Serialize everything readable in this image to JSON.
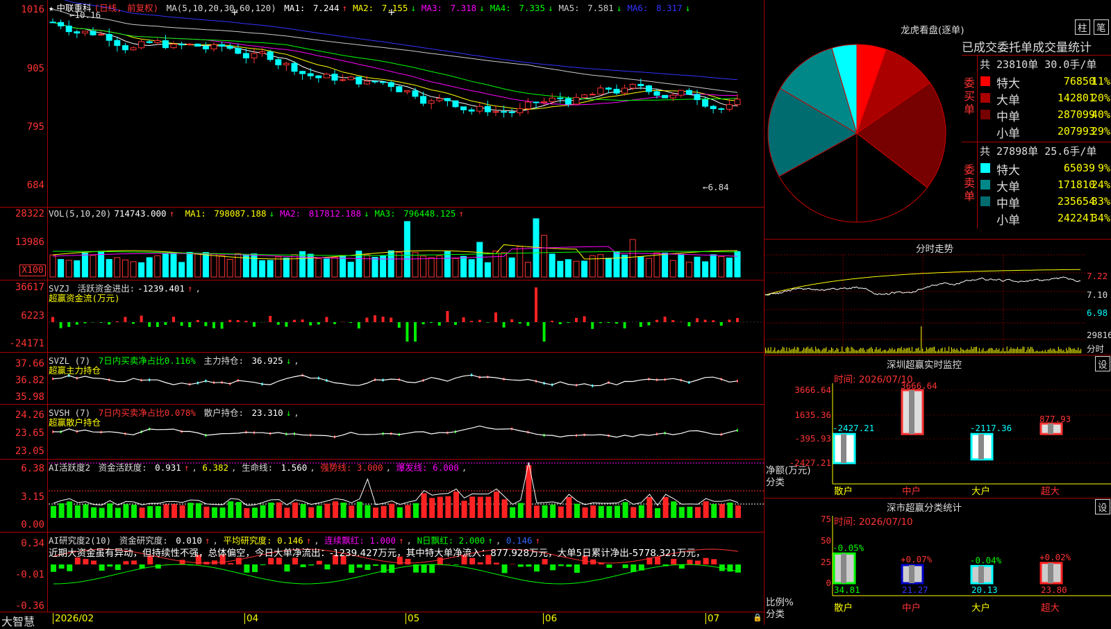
{
  "kline": {
    "title": "中联重科",
    "period": "(日线, 前复权)",
    "ma_def": "MA(5,10,20,30,60,120)",
    "ma": [
      {
        "label": "MA1:",
        "value": "7.244",
        "arrow": "↑",
        "color": "#ffffff"
      },
      {
        "label": "MA2:",
        "value": "7.155",
        "arrow": "↓",
        "color": "#ffff00"
      },
      {
        "label": "MA3:",
        "value": "7.318",
        "arrow": "↓",
        "color": "#ff00ff"
      },
      {
        "label": "MA4:",
        "value": "7.335",
        "arrow": "↓",
        "color": "#00ff00"
      },
      {
        "label": "MA5:",
        "value": "7.581",
        "arrow": "↓",
        "color": "#cccccc"
      },
      {
        "label": "MA6:",
        "value": "8.317",
        "arrow": "↓",
        "color": "#3333ff"
      }
    ],
    "y_ticks": [
      "1016",
      "905",
      "795",
      "684"
    ],
    "high_label": "10.16",
    "low_label": "6.84"
  },
  "vol": {
    "def": "VOL(5,10,20)",
    "value": "714743.000",
    "ma": [
      {
        "label": "MA1:",
        "value": "798087.188",
        "arrow": "↓",
        "color": "#ffff00"
      },
      {
        "label": "MA2:",
        "value": "817812.188",
        "arrow": "↓",
        "color": "#ff00ff"
      },
      {
        "label": "MA3:",
        "value": "796448.125",
        "arrow": "↑",
        "color": "#00ff00"
      }
    ],
    "y_ticks": [
      "28322",
      "13986"
    ],
    "unit": "X100"
  },
  "svzj": {
    "name": "SVZJ",
    "label": "活跃资金进出:",
    "value": "-1239.401",
    "sub": "超赢资金流(万元)",
    "y_ticks": [
      "36617",
      "6223",
      "-24171"
    ]
  },
  "svzl": {
    "name": "SVZL (7)",
    "label7": "7日内买卖净占比0.116%",
    "label2": "主力持仓:",
    "value": "36.925",
    "sub": "超赢主力持仓",
    "y_ticks": [
      "37.66",
      "36.82",
      "35.98"
    ]
  },
  "svsh": {
    "name": "SVSH (7)",
    "label7": "7日内买卖净占比0.078%",
    "label2": "散户持仓:",
    "value": "23.310",
    "sub": "超赢散户持仓",
    "y_ticks": [
      "24.26",
      "23.65",
      "23.05"
    ]
  },
  "ai1": {
    "name": "AI活跃度2",
    "l1": "资金活跃度:",
    "v1": "0.931",
    "v2": "6.382",
    "l3": "生命线:",
    "v3": "1.560",
    "l4": "强势线: 3.000",
    "l5": "爆发线: 6.000",
    "y_ticks": [
      "6.38",
      "3.15",
      "0.00"
    ]
  },
  "ai2": {
    "name": "AI研究度2(10)",
    "l1": "资金研究度:",
    "v1": "0.010",
    "l2": "平均研究度: 0.146",
    "l3": "连续飘红: 1.000",
    "l4": "N日飘红: 2.000",
    "v5": "0.146",
    "comment": "近期大资金虽有异动，但持续性不强，总体偏空，今日大单净流出：-1239.427万元，其中特大单净流入：877.928万元，大单5日累计净出-5778.321万元，",
    "y_ticks": [
      "0.34",
      "-0.01",
      "-0.36"
    ]
  },
  "bottom": {
    "brand": "大智慧",
    "dates": [
      "2026/02",
      "04",
      "05",
      "06",
      "07"
    ]
  },
  "dragon": {
    "title": "龙虎看盘(逐单)",
    "btn1": "柱",
    "btn2": "笔",
    "subtitle": "已成交委托单成交量统计",
    "buy_label": "委买单",
    "sell_label": "委卖单",
    "buy_total": "共 23810单 30.0手/单",
    "sell_total": "共 27898单 25.6手/单",
    "buy_rows": [
      {
        "name": "特大",
        "vol": "76850",
        "pct": "11%",
        "color": "#ff0000"
      },
      {
        "name": "大单",
        "vol": "142801",
        "pct": "20%",
        "color": "#aa0000"
      },
      {
        "name": "中单",
        "vol": "287099",
        "pct": "40%",
        "color": "#770000"
      },
      {
        "name": "小单",
        "vol": "207993",
        "pct": "29%",
        "color": "#000000"
      }
    ],
    "sell_rows": [
      {
        "name": "特大",
        "vol": "65039",
        "pct": "9%",
        "color": "#00ffff"
      },
      {
        "name": "大单",
        "vol": "171810",
        "pct": "24%",
        "color": "#008888"
      },
      {
        "name": "中单",
        "vol": "235654",
        "pct": "33%",
        "color": "#006c70"
      },
      {
        "name": "小单",
        "vol": "242241",
        "pct": "34%",
        "color": "#000000"
      }
    ]
  },
  "intraday": {
    "title": "分时走势",
    "y_ticks": [
      "7.22",
      "7.10",
      "6.98"
    ],
    "vol_label": "29816",
    "vol_label2": "分时"
  },
  "monitor": {
    "title": "深圳超赢实时监控",
    "btn": "设",
    "time": "时间: 2026/07/10",
    "y_ticks": [
      "3666.64",
      "1635.36",
      "-395.93",
      "-2427.21"
    ],
    "y_title": "净额(万元)",
    "x_title": "分类",
    "bars": [
      {
        "name": "散户",
        "value": "-2427.21",
        "label_color": "#00ffff",
        "name_color": "#ffff00"
      },
      {
        "name": "中户",
        "value": "3666.64",
        "label_color": "#ff3333",
        "name_color": "#ff3333"
      },
      {
        "name": "大户",
        "value": "-2117.36",
        "label_color": "#00ffff",
        "name_color": "#ffff00"
      },
      {
        "name": "超大",
        "value": "877.93",
        "label_color": "#ff3333",
        "name_color": "#ff3333"
      }
    ]
  },
  "classify": {
    "title": "深市超赢分类统计",
    "btn": "设",
    "time": "时间: 2026/07/10",
    "y_ticks": [
      "75",
      "50",
      "25",
      "0"
    ],
    "y_title": "比例%",
    "x_title": "分类",
    "bars": [
      {
        "name": "散户",
        "value": "34.81",
        "change": "-0.05%",
        "val_color": "#00ff00",
        "chg_color": "#00ff00",
        "name_color": "#ffff00"
      },
      {
        "name": "中户",
        "value": "21.27",
        "change": "+0.07%",
        "val_color": "#3333ff",
        "chg_color": "#ff3333",
        "name_color": "#ff3333"
      },
      {
        "name": "大户",
        "value": "20.13",
        "change": "-0.04%",
        "val_color": "#00ffff",
        "chg_color": "#00ff00",
        "name_color": "#ffff00"
      },
      {
        "name": "超大",
        "value": "23.80",
        "change": "+0.02%",
        "val_color": "#ff3333",
        "chg_color": "#ff3333",
        "name_color": "#ff3333"
      }
    ]
  }
}
